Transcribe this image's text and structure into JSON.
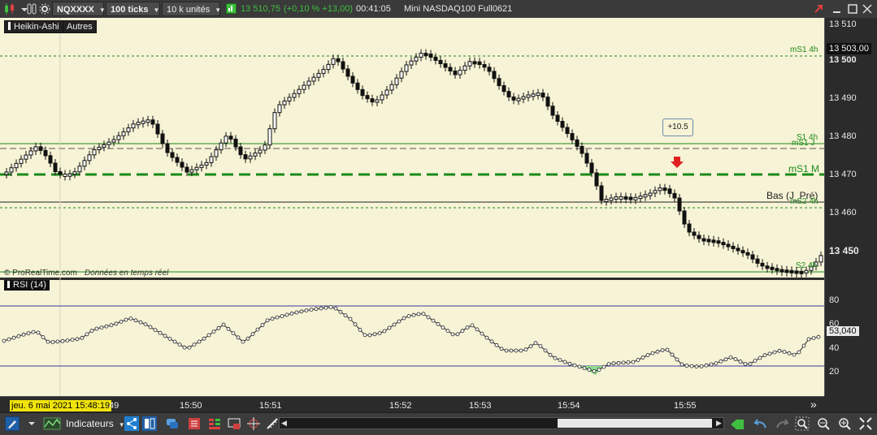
{
  "toolbar": {
    "symbol": "NQXXXX",
    "ticks": "100 ticks",
    "units": "10 k unités",
    "price": "13 510,75",
    "change": "(+0,10 % +13,00)",
    "time": "00:41:05",
    "instrument": "Mini NASDAQ100 Full0621"
  },
  "chart": {
    "type_button": "Heikin-Ashi",
    "other_button": "Autres",
    "copyright": "© ProRealTime.com",
    "realtime": "Données en temps réel",
    "tooltip": "+10.5"
  },
  "levels": {
    "ms1_4h": "mS1 4h",
    "s1_4h": "S1 4h",
    "ms1_j": "mS1 J",
    "ms1_m": "mS1 M",
    "bas_j_pre": "Bas (J_Pré)",
    "ms2_4h": "mS2 4h",
    "s2_4h": "S2 4h"
  },
  "price_axis": {
    "ticks": [
      "13 510",
      "13 500",
      "13 490",
      "13 480",
      "13 470",
      "13 460",
      "13 450"
    ],
    "current": "13 503,00"
  },
  "rsi": {
    "label": "RSI (14)",
    "ticks": [
      "80",
      "60",
      "40",
      "20"
    ],
    "current": "53,040"
  },
  "time_axis": {
    "cursor": "jeu. 6 mai 2021 15:48:19",
    "labels": [
      "49",
      "15:50",
      "15:51",
      "15:52",
      "15:53",
      "15:54",
      "15:55"
    ],
    "scroll_icon": "»"
  },
  "bottom": {
    "indicators": "Indicateurs"
  },
  "colors": {
    "chart_bg": "#f7f3d6",
    "green_level": "#1a8a1a",
    "price_up": "#3fbf3f",
    "arrow": "#e02020"
  }
}
